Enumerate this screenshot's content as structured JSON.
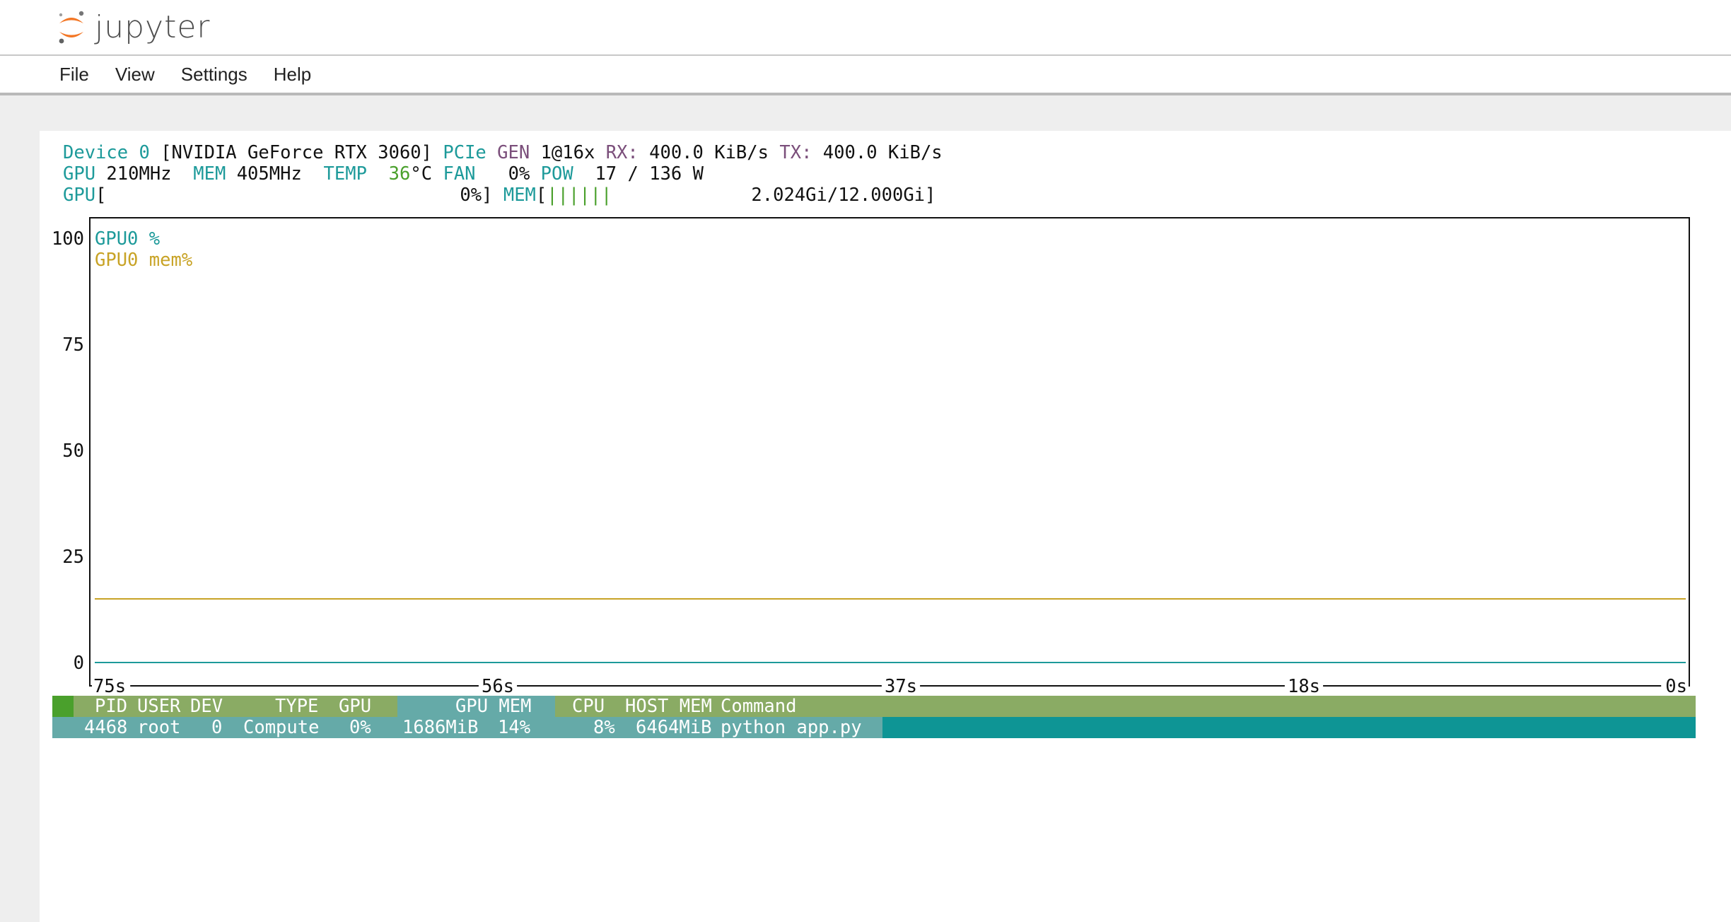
{
  "app": {
    "name": "jupyter"
  },
  "menu": [
    "File",
    "View",
    "Settings",
    "Help"
  ],
  "nvtop": {
    "device_line": {
      "device_label": "Device 0",
      "device_name": "[NVIDIA GeForce RTX 3060]",
      "pcie_label": "PCIe",
      "gen_label": "GEN",
      "gen_value": "1@16x",
      "rx_label": "RX:",
      "rx_value": "400.0 KiB/s",
      "tx_label": "TX:",
      "tx_value": "400.0 KiB/s"
    },
    "clock_line": {
      "gpu_label": "GPU",
      "gpu_value": "210MHz",
      "mem_label": "MEM",
      "mem_value": "405MHz",
      "temp_label": "TEMP",
      "temp_value": "36",
      "temp_unit": "°C",
      "fan_label": "FAN",
      "fan_value": "0%",
      "pow_label": "POW",
      "pow_value": "17 / 136 W"
    },
    "bar_line": {
      "gpu_label": "GPU",
      "gpu_bar_open": "[",
      "gpu_percent_text": "0%]",
      "gpu_util": 0,
      "mem_label": "MEM",
      "mem_bar_open": "[",
      "mem_bar_fill": "||||||",
      "mem_text": "2.024Gi/12.000Gi]"
    }
  },
  "chart_data": {
    "type": "line",
    "x_ticks": [
      "75s",
      "56s",
      "37s",
      "18s",
      "0s"
    ],
    "xlim": [
      75,
      0
    ],
    "y_ticks": [
      "100",
      "75",
      "50",
      "25",
      "0"
    ],
    "ylim": [
      0,
      100
    ],
    "series": [
      {
        "name": "GPU0 %",
        "color": "#1d9a9a",
        "x": [
          75,
          0
        ],
        "y": [
          0,
          0
        ]
      },
      {
        "name": "GPU0 mem%",
        "color": "#c8a326",
        "x": [
          75,
          0
        ],
        "y": [
          15,
          15
        ]
      }
    ]
  },
  "process_table": {
    "headers": {
      "pid": "PID",
      "user": "USER",
      "dev": "DEV",
      "type": "TYPE",
      "gpu": "GPU",
      "gpu_mem": "GPU MEM",
      "cpu": "CPU",
      "host_mem": "HOST MEM",
      "command": "Command"
    },
    "rows": [
      {
        "pid": "4468",
        "user": "root",
        "dev": "0",
        "type": "Compute",
        "gpu": "0%",
        "gpu_mem": "1686MiB",
        "gpu_mem_pct": "14%",
        "cpu": "8%",
        "host_mem": "6464MiB",
        "command": "python app.py"
      }
    ]
  },
  "colors": {
    "teal": "#1d9a9a",
    "purple": "#7b4f7b",
    "green": "#4aa02c",
    "mem_line": "#c8a326",
    "header_green": "#8aab64",
    "header_teal": "#65aaa8",
    "row_teal": "#0e9595",
    "row_light": "#65aaa8"
  }
}
